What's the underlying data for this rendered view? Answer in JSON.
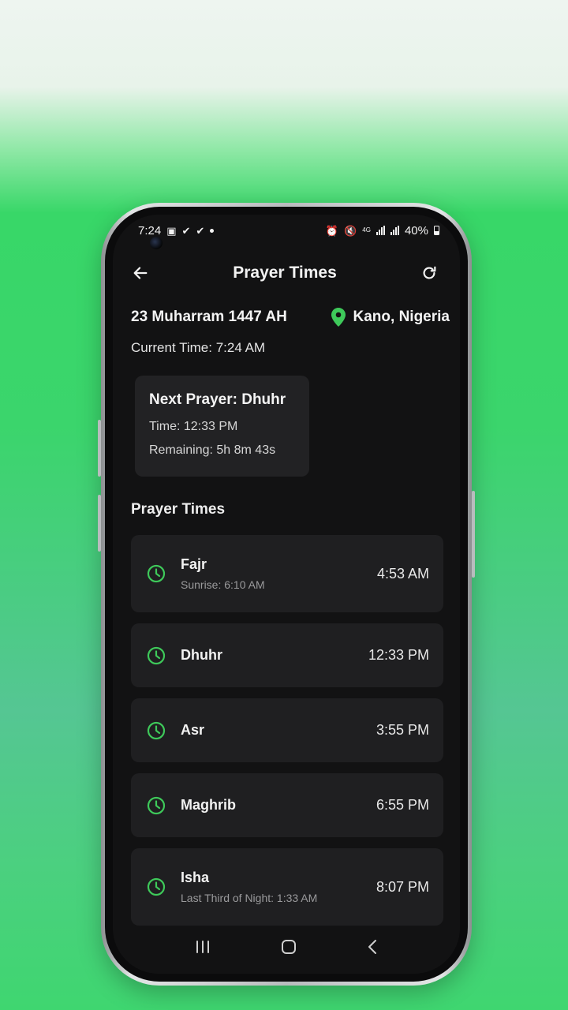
{
  "status_bar": {
    "time": "7:24",
    "battery": "40%",
    "network": "4G"
  },
  "app_bar": {
    "title": "Prayer Times"
  },
  "header": {
    "hijri_date": "23 Muharram 1447 AH",
    "location": "Kano, Nigeria",
    "current_time": "Current Time: 7:24 AM"
  },
  "next_prayer": {
    "title": "Next Prayer: Dhuhr",
    "time": "Time: 12:33 PM",
    "remaining": "Remaining: 5h 8m 43s"
  },
  "section_title": "Prayer Times",
  "prayers": [
    {
      "name": "Fajr",
      "sub": "Sunrise: 6:10 AM",
      "time": "4:53 AM"
    },
    {
      "name": "Dhuhr",
      "sub": "",
      "time": "12:33 PM"
    },
    {
      "name": "Asr",
      "sub": "",
      "time": "3:55 PM"
    },
    {
      "name": "Maghrib",
      "sub": "",
      "time": "6:55 PM"
    },
    {
      "name": "Isha",
      "sub": "Last Third of Night: 1:33 AM",
      "time": "8:07 PM"
    }
  ],
  "colors": {
    "accent": "#3ec95a",
    "card": "#1f1f21",
    "screen": "#121213"
  },
  "icons": [
    "back-arrow-icon",
    "refresh-icon",
    "location-pin-icon",
    "clock-icon",
    "recent-apps-icon",
    "home-icon",
    "nav-back-icon"
  ]
}
